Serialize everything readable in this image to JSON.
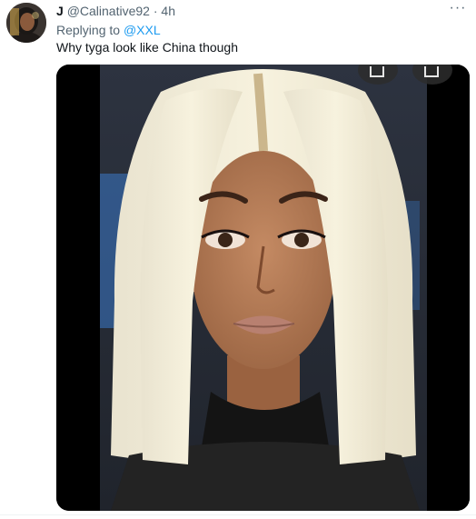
{
  "tweet": {
    "author_name": "J",
    "author_handle": "@Calinative92",
    "separator": "·",
    "timestamp": "4h",
    "more_label": "···",
    "replying_prefix": "Replying to",
    "replying_to": "@XXL",
    "text": "Why tyga look like China though"
  },
  "colors": {
    "link": "#1d9bf0",
    "secondary_text": "#536471",
    "primary_text": "#0f1419"
  },
  "icons": {
    "more": "more-horizontal-icon",
    "media_share": "share-icon",
    "media_bookmark": "bookmark-icon"
  }
}
